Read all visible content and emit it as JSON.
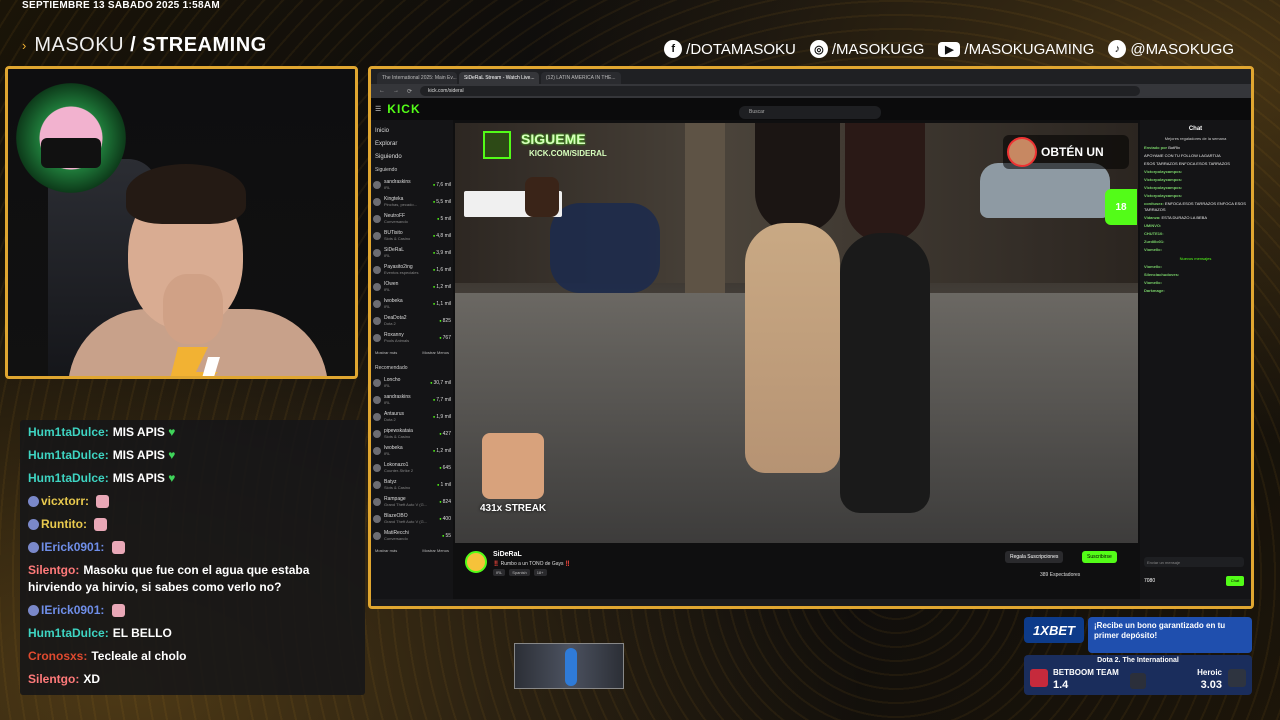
{
  "header": {
    "datetime": "SEPTIEMBRE 13 SABADO 2025 1:58AM",
    "brand_light": "MASOKU",
    "brand_bold": "/ STREAMING"
  },
  "socials": [
    {
      "icon": "facebook-icon",
      "glyph": "f",
      "label": "/DOTAMASOKU"
    },
    {
      "icon": "instagram-icon",
      "glyph": "◎",
      "label": "/MASOKUGG"
    },
    {
      "icon": "youtube-icon",
      "glyph": "▶",
      "label": "/MASOKUGAMING"
    },
    {
      "icon": "tiktok-icon",
      "glyph": "♪",
      "label": "@MASOKUGG"
    }
  ],
  "browser": {
    "tabs": [
      "The International 2025: Main Ev...",
      "SiDeRaL Stream - Watch Live...",
      "(12) LATIN AMERICA IN THE..."
    ],
    "url": "kick.com/sideral",
    "logo": "KICK",
    "search_placeholder": "Buscar"
  },
  "kick_sidebar": {
    "nav": [
      "Inicio",
      "Explorar",
      "Siguiendo"
    ],
    "following_header": "Siguiendo",
    "following": [
      {
        "name": "sandraskins",
        "sub": "IRL",
        "count": "7,6 mil"
      },
      {
        "name": "Kingteka",
        "sub": "Pinchas, pecado...",
        "count": "5,5 mil"
      },
      {
        "name": "NeutroFF",
        "sub": "Conversando",
        "count": "5 mil"
      },
      {
        "name": "BUTisito",
        "sub": "Slots & Casino",
        "count": "4,8 mil"
      },
      {
        "name": "SiDeRaL",
        "sub": "IRL",
        "count": "3,9 mil"
      },
      {
        "name": "Payasito2ing",
        "sub": "Eventos especiales",
        "count": "1,6 mil"
      },
      {
        "name": "IOwen",
        "sub": "IRL",
        "count": "1,2 mil"
      },
      {
        "name": "Iwobeka",
        "sub": "IRL",
        "count": "1,1 mil"
      },
      {
        "name": "DeaDota2",
        "sub": "Dota 2",
        "count": "825"
      },
      {
        "name": "Roxanny",
        "sub": "Pools Animals",
        "count": "767"
      }
    ],
    "show_more": "Mostrar más",
    "show_less": "Mostrar Menos",
    "recommended_header": "Recomendado",
    "recommended": [
      {
        "name": "Loncho",
        "sub": "IRL",
        "count": "30,7 mil"
      },
      {
        "name": "sandraskins",
        "sub": "IRL",
        "count": "7,7 mil"
      },
      {
        "name": "Antaurus",
        "sub": "Dota 2",
        "count": "1,9 mil"
      },
      {
        "name": "pipewskataia",
        "sub": "Slots & Casino",
        "count": "427"
      },
      {
        "name": "Iwobeka",
        "sub": "IRL",
        "count": "1,2 mil"
      },
      {
        "name": "Lokonazo1",
        "sub": "Counter-Strike 2",
        "count": "645"
      },
      {
        "name": "Batyz",
        "sub": "Slots & Casino",
        "count": "1 mil"
      },
      {
        "name": "Rampage",
        "sub": "Grand Theft Auto V (G...",
        "count": "824"
      },
      {
        "name": "BlazeOBO",
        "sub": "Grand Theft Auto V (G...",
        "count": "400"
      },
      {
        "name": "MatiRecchi",
        "sub": "Conversando",
        "count": "55"
      }
    ]
  },
  "video": {
    "follow_text": "SIGUEME",
    "follow_url": "KICK.COM/SIDERAL",
    "obten": "OBTÉN UN",
    "age": "18",
    "streak": "431x STREAK"
  },
  "stream_info": {
    "name": "SiDeRaL",
    "title": "‼️ Rumbo a un TONO de Gays ‼️",
    "tags": [
      "IRL",
      "Spanish",
      "18+"
    ],
    "gift_btn": "Regala Suscripciones",
    "sub_btn": "Suscribirse",
    "viewers": "389 Espectadores"
  },
  "kick_chat": {
    "title": "Chat",
    "subtitle": "Mejores regaladores de la semana",
    "lines": [
      {
        "user": "Enviado por",
        "msg": "BotRix"
      },
      {
        "user": "",
        "msg": "APOYAME CON TU FOLLOW LAGARTIJA"
      },
      {
        "user": "",
        "msg": "ESOS TARRAZOS ENFOCA ESOS TARRAZOS"
      },
      {
        "user": "Victorpolaycampos:",
        "msg": ""
      },
      {
        "user": "Victorpolaycampos:",
        "msg": ""
      },
      {
        "user": "Victorpolaycampos:",
        "msg": ""
      },
      {
        "user": "Victorpolaycampos:",
        "msg": ""
      },
      {
        "user": "conitusez:",
        "msg": "ENFOCA ESOS TARRAZOS ENFOCA ESOS TARRAZOS"
      },
      {
        "user": "Vidanza:",
        "msg": "ESTA DURAZO LA BEBA"
      },
      {
        "user": "UMINVO:",
        "msg": ""
      },
      {
        "user": "CHUTE10:",
        "msg": ""
      },
      {
        "user": "Zurdillo01:",
        "msg": ""
      },
      {
        "user": "Viomello:",
        "msg": ""
      }
    ],
    "new_messages": "Nuevos mensajes",
    "after_lines": [
      {
        "user": "Viomello:",
        "msg": ""
      },
      {
        "user": "Silenciachudoves:",
        "msg": ""
      },
      {
        "user": "Viomello:",
        "msg": ""
      },
      {
        "user": "Darkmage:",
        "msg": ""
      }
    ],
    "input_placeholder": "Enviar un mensaje",
    "points": "7080",
    "send": "Chat"
  },
  "overlay_chat": [
    {
      "user": "Hum1taDulce:",
      "user_color": "#3ed4c2",
      "msg": "MIS APIS",
      "emote": "heart"
    },
    {
      "user": "Hum1taDulce:",
      "user_color": "#3ed4c2",
      "msg": "MIS APIS",
      "emote": "heart"
    },
    {
      "user": "Hum1taDulce:",
      "user_color": "#3ed4c2",
      "msg": "MIS APIS",
      "emote": "heart"
    },
    {
      "user": "vicxtorr:",
      "user_color": "#e8c94e",
      "msg": "",
      "emote": "img"
    },
    {
      "user": "Runtito:",
      "user_color": "#e8c94e",
      "msg": "",
      "emote": "img"
    },
    {
      "user": "IErick0901:",
      "user_color": "#6f8ee8",
      "msg": "",
      "emote": "img"
    },
    {
      "user": "Silentgo:",
      "user_color": "#ff7a7a",
      "msg": "Masoku que fue con el agua que estaba hirviendo ya hirvio, si sabes como verlo no?",
      "emote": ""
    },
    {
      "user": "IErick0901:",
      "user_color": "#6f8ee8",
      "msg": "",
      "emote": "img"
    },
    {
      "user": "Hum1taDulce:",
      "user_color": "#3ed4c2",
      "msg": "EL BELLO",
      "emote": ""
    },
    {
      "user": "Cronosxs:",
      "user_color": "#e04a2f",
      "msg": "Tecleale al cholo",
      "emote": ""
    },
    {
      "user": "Silentgo:",
      "user_color": "#ff7a7a",
      "msg": "XD",
      "emote": ""
    }
  ],
  "bet": {
    "logo": "1XBET",
    "promo": "¡Recibe un bono garantizado en tu primer depósito!",
    "match_title": "Dota 2. The International",
    "team_a": "BETBOOM TEAM",
    "team_a_odds": "1.4",
    "team_b": "Heroic",
    "team_b_odds": "3.03"
  }
}
